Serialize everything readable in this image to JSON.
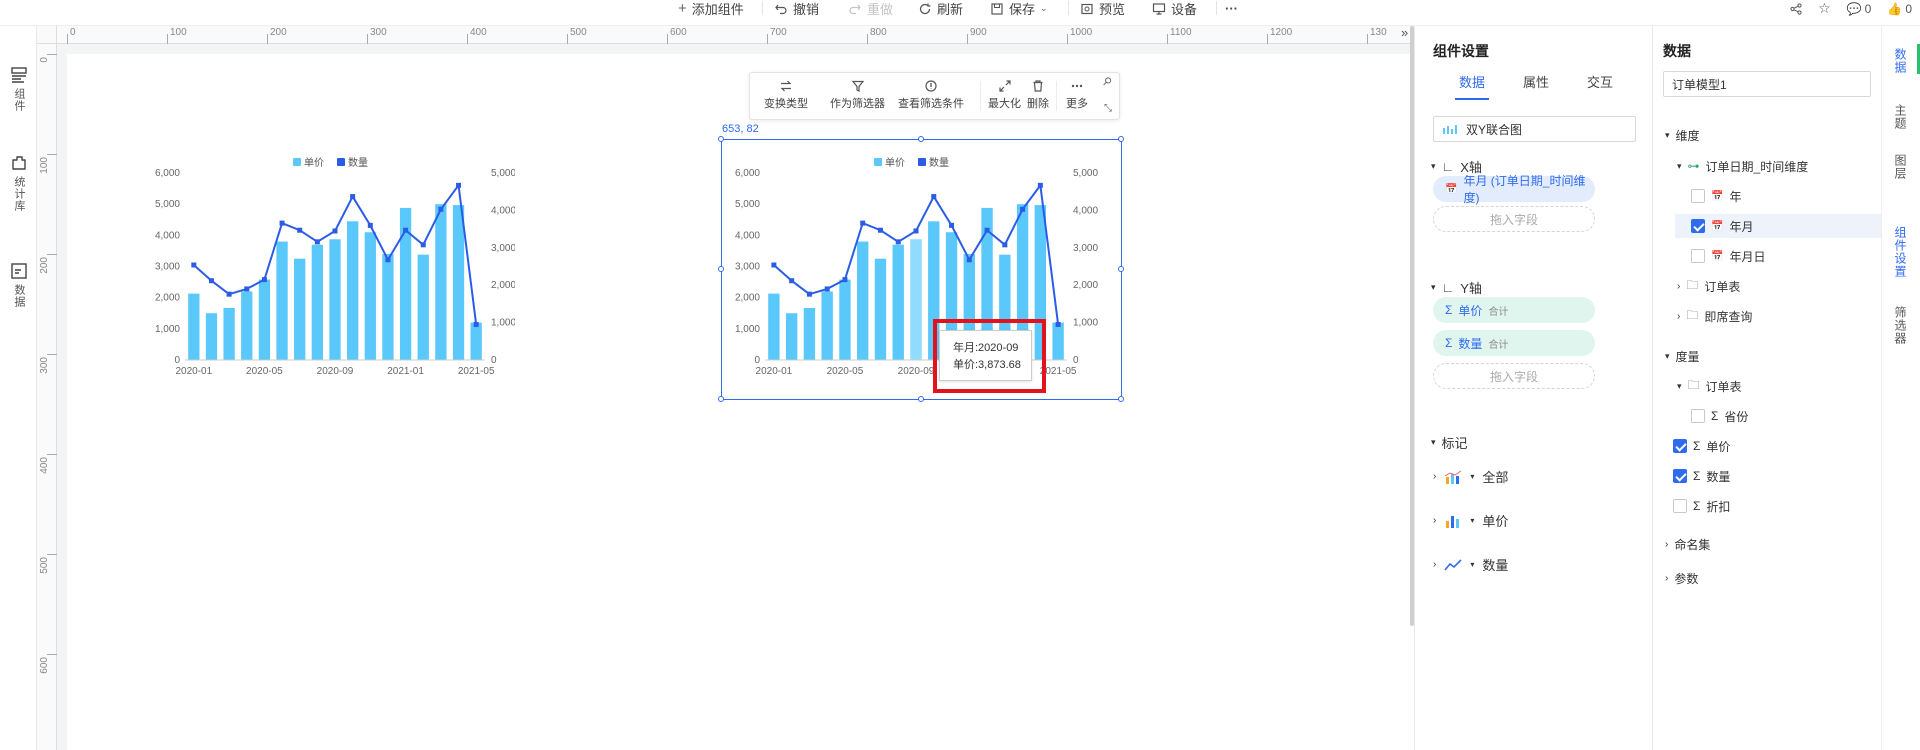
{
  "toolbar": {
    "add_component": "添加组件",
    "undo": "撤销",
    "redo": "重做",
    "refresh": "刷新",
    "save": "保存",
    "preview": "预览",
    "device": "设备",
    "more": "···",
    "comments": "0",
    "likes": "0"
  },
  "left_sidebar": {
    "items": [
      {
        "label": "组件",
        "icon": "component-icon"
      },
      {
        "label": "统计库",
        "icon": "stats-library-icon"
      },
      {
        "label": "数据",
        "icon": "data-icon"
      }
    ]
  },
  "ruler": {
    "h_ticks": [
      "0",
      "100",
      "200",
      "300",
      "400",
      "500",
      "600",
      "700",
      "800",
      "900",
      "1000",
      "1100",
      "1200",
      "130"
    ],
    "v_ticks": [
      "0",
      "100",
      "200",
      "300",
      "400",
      "500",
      "600"
    ]
  },
  "chart_toolbar": {
    "buttons": [
      "变换类型",
      "作为筛选器",
      "查看筛选条件",
      "最大化",
      "删除",
      "更多"
    ]
  },
  "selection": {
    "coord_label": "653, 82"
  },
  "tooltip": {
    "line1": "年月:2020-09",
    "line2": "单价:3,873.68"
  },
  "chart_data": [
    {
      "type": "bar",
      "categories": [
        "2020-01",
        "2020-02",
        "2020-03",
        "2020-04",
        "2020-05",
        "2020-06",
        "2020-07",
        "2020-08",
        "2020-09",
        "2020-10",
        "2020-11",
        "2020-12",
        "2021-01",
        "2021-02",
        "2021-03",
        "2021-04",
        "2021-05"
      ],
      "x_tick_labels": [
        "2020-01",
        "2020-05",
        "2020-09",
        "2021-01",
        "2021-05"
      ],
      "series": [
        {
          "name": "单价",
          "type": "bar",
          "axis": "left",
          "color": "#5ac8fa",
          "values": [
            2130,
            1500,
            1670,
            2200,
            2580,
            3800,
            3250,
            3700,
            3874,
            4450,
            4100,
            3400,
            4880,
            3380,
            5000,
            4970,
            1200
          ]
        },
        {
          "name": "数量",
          "type": "line",
          "axis": "right",
          "color": "#2b5ce6",
          "values": [
            2540,
            2120,
            1760,
            1900,
            2150,
            3660,
            3470,
            3160,
            3450,
            4370,
            3600,
            2680,
            3470,
            3080,
            4030,
            4670,
            950
          ]
        }
      ],
      "y_left": {
        "min": 0,
        "max": 6000,
        "ticks": [
          "0",
          "1,000",
          "2,000",
          "3,000",
          "4,000",
          "5,000",
          "6,000"
        ]
      },
      "y_right": {
        "min": 0,
        "max": 5000,
        "ticks": [
          "0",
          "1,000",
          "2,000",
          "3,000",
          "4,000",
          "5,000"
        ]
      },
      "legend": "top-center",
      "grid": false
    }
  ],
  "panel_settings": {
    "title": "组件设置",
    "tabs": [
      "数据",
      "属性",
      "交互"
    ],
    "chart_type": "双Y联合图",
    "x_axis_label": "X轴",
    "x_field": "年月 (订单日期_时间维度)",
    "drop_hint": "拖入字段",
    "y_axis_label": "Y轴",
    "y_fields": [
      {
        "name": "单价",
        "agg": "合计"
      },
      {
        "name": "数量",
        "agg": "合计"
      }
    ],
    "marks_label": "标记",
    "marks": [
      "全部",
      "单价",
      "数量"
    ]
  },
  "panel_data": {
    "title": "数据",
    "model": "订单模型1",
    "dimension_label": "维度",
    "time_dim": "订单日期_时间维度",
    "time_items": [
      {
        "label": "年",
        "checked": false
      },
      {
        "label": "年月",
        "checked": true
      },
      {
        "label": "年月日",
        "checked": false
      }
    ],
    "folders": [
      "订单表",
      "即席查询"
    ],
    "measure_label": "度量",
    "measure_folder": "订单表",
    "measures": [
      {
        "label": "省份",
        "checked": false
      },
      {
        "label": "单价",
        "checked": true
      },
      {
        "label": "数量",
        "checked": true
      },
      {
        "label": "折扣",
        "checked": false
      }
    ],
    "named_sets": "命名集",
    "params": "参数"
  },
  "right_sidebar": [
    "数据",
    "主题",
    "图层",
    "组件设置",
    "筛选器"
  ]
}
